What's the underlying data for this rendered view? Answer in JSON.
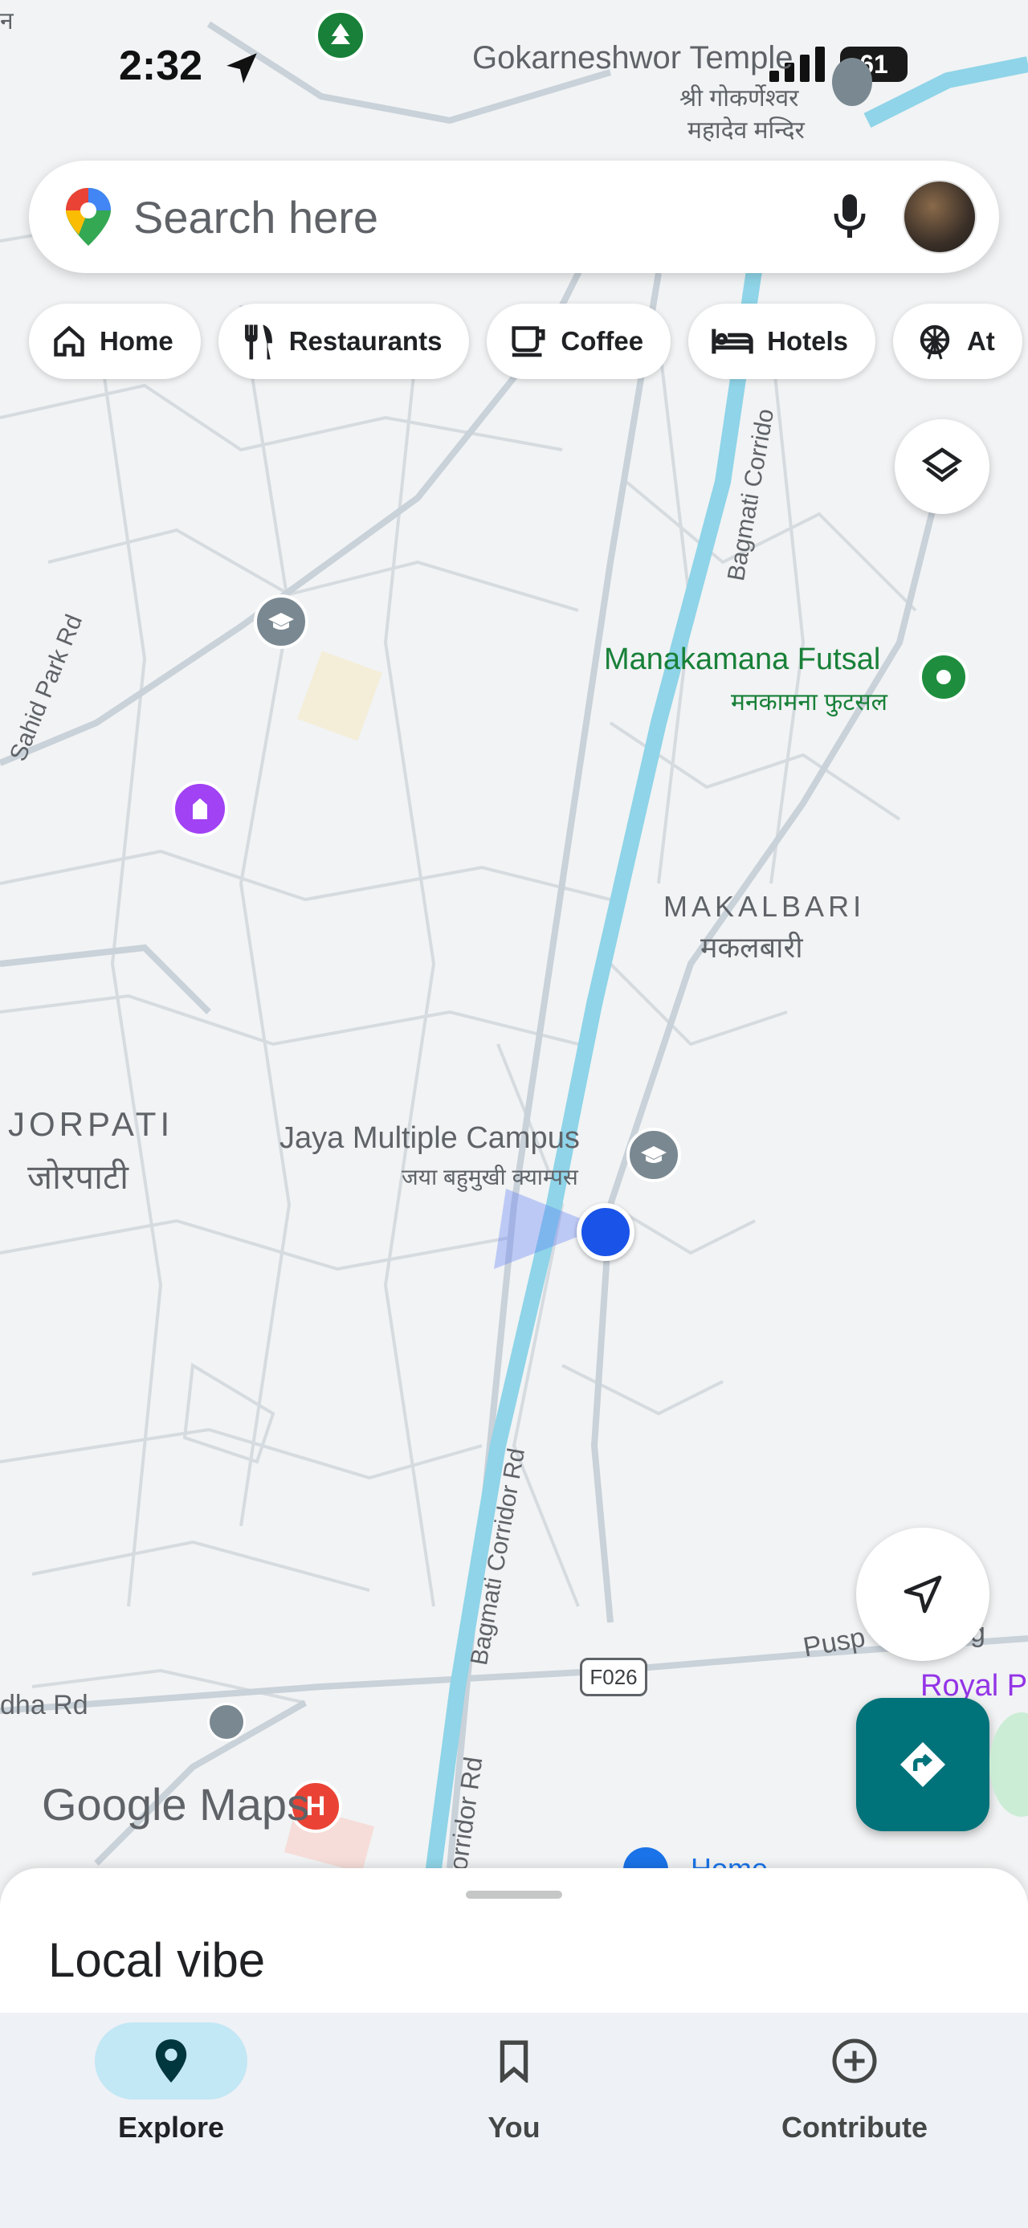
{
  "status": {
    "time": "2:32",
    "battery": "61"
  },
  "search": {
    "placeholder": "Search here"
  },
  "chips": [
    {
      "label": "Home",
      "icon": "home-icon"
    },
    {
      "label": "Restaurants",
      "icon": "fork-knife-icon"
    },
    {
      "label": "Coffee",
      "icon": "coffee-cup-icon"
    },
    {
      "label": "Hotels",
      "icon": "bed-icon"
    },
    {
      "label": "At",
      "icon": "ferris-wheel-icon"
    }
  ],
  "map": {
    "labels": {
      "temple_en": "Gokarneshwor Temple",
      "temple_ne1": "श्री गोकर्णेश्वर",
      "temple_ne2": "महादेव मन्दिर",
      "corner_ne": "न",
      "futsal_en": "Manakamana Futsal",
      "futsal_ne": "मनकामना फुटसल",
      "makalbari_en": "MAKALBARI",
      "makalbari_ne": "मकलबारी",
      "jorpati_en": "JORPATI",
      "jorpati_ne": "जोरपाटी",
      "campus_en": "Jaya Multiple Campus",
      "campus_ne": "जया बहुमुखी क्याम्पस",
      "road_bagmati_top": "Bagmati Corrido",
      "road_bagmati_mid": "Bagmati Corridor Rd",
      "road_bagmati_bottom": "orridor Rd",
      "road_sahid": "Sahid Park Rd",
      "road_pusp": "Pusp",
      "road_pusp_g": "g",
      "road_dha": "dha Rd",
      "road_code": "F026",
      "royal": "Royal Pa",
      "home_partial": "Home"
    },
    "watermark": {
      "google": "Google",
      "maps": "Maps"
    }
  },
  "sheet": {
    "title": "Local vibe"
  },
  "nav": [
    {
      "label": "Explore",
      "icon": "location-pin-icon",
      "active": true
    },
    {
      "label": "You",
      "icon": "bookmark-icon",
      "active": false
    },
    {
      "label": "Contribute",
      "icon": "add-circle-icon",
      "active": false
    }
  ],
  "colors": {
    "accent": "#00727a",
    "river": "#8fd4e8",
    "location": "#1a53e8",
    "nav_active": "#c2e7f5"
  }
}
